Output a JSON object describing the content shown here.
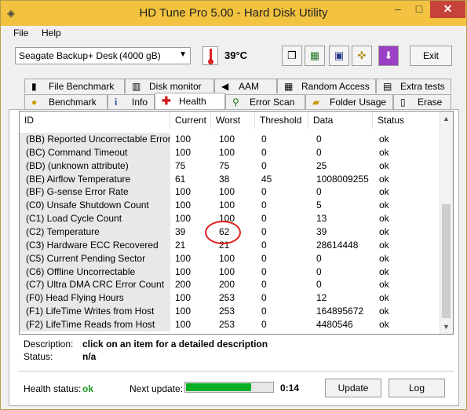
{
  "window": {
    "title": "HD Tune Pro 5.00 - Hard Disk Utility",
    "min": "–",
    "max": "□",
    "close": "✕"
  },
  "menu": {
    "file": "File",
    "help": "Help"
  },
  "toolbar": {
    "drive": "Seagate Backup+ Desk",
    "capacity": "(4000 gB)",
    "temperature": "39°C",
    "exit": "Exit"
  },
  "tabs_top": [
    {
      "label": "File Benchmark",
      "icon": "file-benchmark-icon"
    },
    {
      "label": "Disk monitor",
      "icon": "disk-monitor-icon"
    },
    {
      "label": "AAM",
      "icon": "speaker-icon"
    },
    {
      "label": "Random Access",
      "icon": "random-access-icon"
    },
    {
      "label": "Extra tests",
      "icon": "extra-tests-icon"
    }
  ],
  "tabs_bottom": [
    {
      "label": "Benchmark",
      "icon": "lightbulb-icon"
    },
    {
      "label": "Info",
      "icon": "info-icon"
    },
    {
      "label": "Health",
      "icon": "red-cross-icon",
      "active": true
    },
    {
      "label": "Error Scan",
      "icon": "magnifier-icon"
    },
    {
      "label": "Folder Usage",
      "icon": "folder-icon"
    },
    {
      "label": "Erase",
      "icon": "trash-icon"
    }
  ],
  "table": {
    "headers": [
      "ID",
      "Current",
      "Worst",
      "Threshold",
      "Data",
      "Status"
    ],
    "rows": [
      [
        "(BB) Reported Uncorrectable Errors",
        "100",
        "100",
        "0",
        "0",
        "ok"
      ],
      [
        "(BC) Command Timeout",
        "100",
        "100",
        "0",
        "0",
        "ok"
      ],
      [
        "(BD) (unknown attribute)",
        "75",
        "75",
        "0",
        "25",
        "ok"
      ],
      [
        "(BE) Airflow Temperature",
        "61",
        "38",
        "45",
        "1008009255",
        "ok"
      ],
      [
        "(BF) G-sense Error Rate",
        "100",
        "100",
        "0",
        "0",
        "ok"
      ],
      [
        "(C0) Unsafe Shutdown Count",
        "100",
        "100",
        "0",
        "5",
        "ok"
      ],
      [
        "(C1) Load Cycle Count",
        "100",
        "100",
        "0",
        "13",
        "ok"
      ],
      [
        "(C2) Temperature",
        "39",
        "62",
        "0",
        "39",
        "ok"
      ],
      [
        "(C3) Hardware ECC Recovered",
        "21",
        "21",
        "0",
        "28614448",
        "ok"
      ],
      [
        "(C5) Current Pending Sector",
        "100",
        "100",
        "0",
        "0",
        "ok"
      ],
      [
        "(C6) Offline Uncorrectable",
        "100",
        "100",
        "0",
        "0",
        "ok"
      ],
      [
        "(C7) Ultra DMA CRC Error Count",
        "200",
        "200",
        "0",
        "0",
        "ok"
      ],
      [
        "(F0) Head Flying Hours",
        "100",
        "253",
        "0",
        "12",
        "ok"
      ],
      [
        "(F1) LifeTime Writes from Host",
        "100",
        "253",
        "0",
        "164895672",
        "ok"
      ],
      [
        "(F2) LifeTime Reads from Host",
        "100",
        "253",
        "0",
        "4480546",
        "ok"
      ]
    ]
  },
  "details": {
    "description_label": "Description:",
    "description_value": "click on an item for a detailed description",
    "status_label": "Status:",
    "status_value": "n/a"
  },
  "footer": {
    "health_label": "Health status:",
    "health_value": "ok",
    "next_update_label": "Next update:",
    "progress_fraction": 0.75,
    "timer": "0:14",
    "update": "Update",
    "log": "Log"
  },
  "colors": {
    "titlebar": "#f2c240",
    "health_ok": "#1e9a1e",
    "progress": "#06b025",
    "highlight_circle": "#e0201c"
  }
}
